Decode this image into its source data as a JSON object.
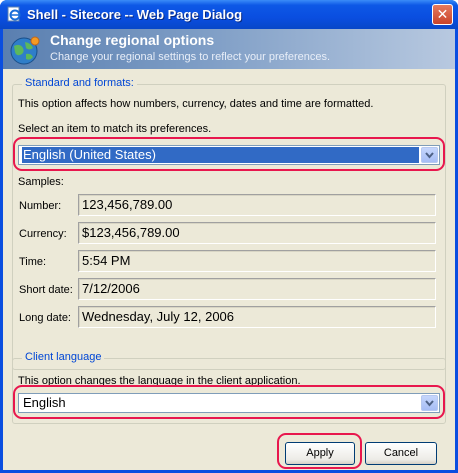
{
  "window": {
    "title": "Shell - Sitecore -- Web Page Dialog",
    "close_glyph": "✕"
  },
  "banner": {
    "title": "Change regional options",
    "subtitle": "Change your regional settings to reflect your preferences."
  },
  "standard": {
    "legend": "Standard and formats:",
    "description": "This option affects how numbers, currency, dates and time are formatted.",
    "select_prompt": "Select an item to match its preferences.",
    "selected_locale": "English (United States)",
    "samples_label": "Samples:",
    "samples": [
      {
        "label": "Number:",
        "value": "123,456,789.00"
      },
      {
        "label": "Currency:",
        "value": "$123,456,789.00"
      },
      {
        "label": "Time:",
        "value": "5:54 PM"
      },
      {
        "label": "Short date:",
        "value": "7/12/2006"
      },
      {
        "label": "Long date:",
        "value": "Wednesday, July 12, 2006"
      }
    ]
  },
  "client_language": {
    "legend": "Client language",
    "description": "This option changes the language in the client application.",
    "selected_language": "English"
  },
  "buttons": {
    "apply": "Apply",
    "cancel": "Cancel"
  },
  "colors": {
    "title_bar": "#0a4ee0",
    "highlight": "#e8174d",
    "legend_text": "#0046d5",
    "dialog_bg": "#ece9d8"
  }
}
